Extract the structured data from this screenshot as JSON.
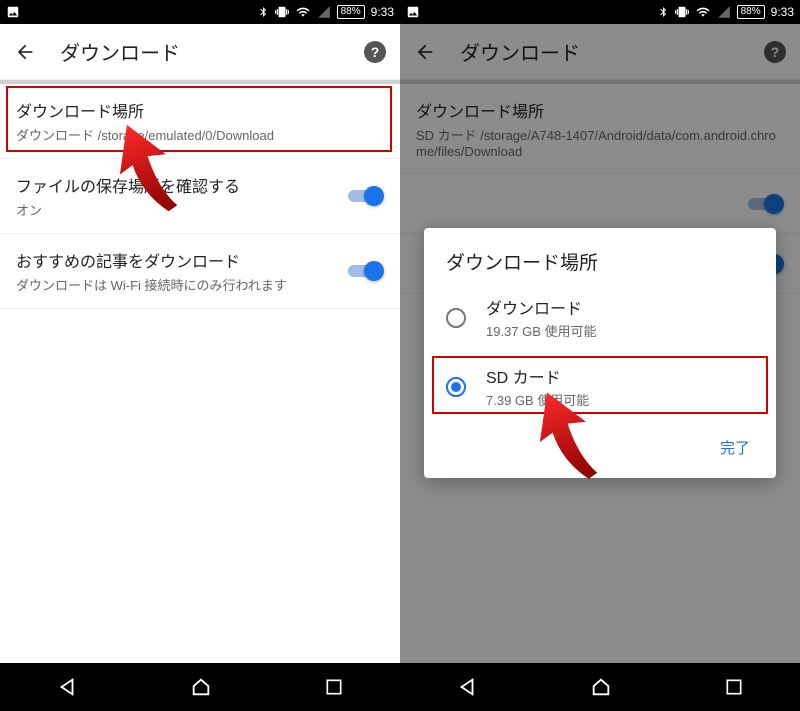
{
  "status": {
    "battery": "88%",
    "time": "9:33"
  },
  "left": {
    "title": "ダウンロード",
    "items": [
      {
        "title": "ダウンロード場所",
        "sub_prefix": "ダウンロード ",
        "sub_path": "/storage/emulated/0/Download"
      },
      {
        "title": "ファイルの保存場所を確認する",
        "sub": "オン"
      },
      {
        "title": "おすすめの記事をダウンロード",
        "sub": "ダウンロードは Wi-Fi 接続時にのみ行われます"
      }
    ]
  },
  "right": {
    "title": "ダウンロード",
    "bg_item": {
      "title": "ダウンロード場所",
      "sub": "SD カード /storage/A748-1407/Android/data/com.android.chrome/files/Download"
    },
    "dialog": {
      "title": "ダウンロード場所",
      "options": [
        {
          "label": "ダウンロード",
          "sub": "19.37 GB 使用可能"
        },
        {
          "label": "SD カード",
          "sub": "7.39 GB 使用可能"
        }
      ],
      "done": "完了"
    }
  }
}
